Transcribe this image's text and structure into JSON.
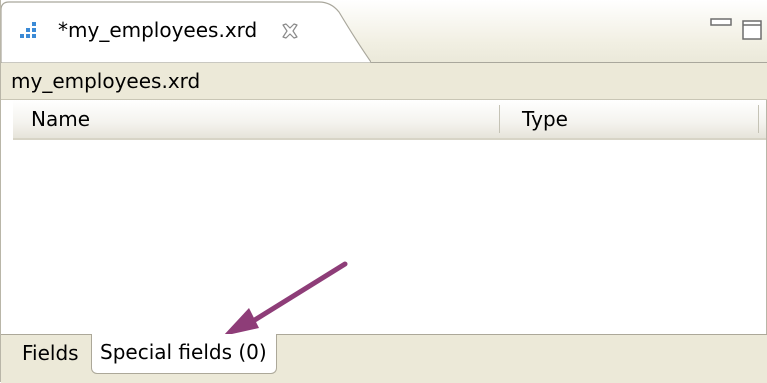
{
  "editor_tab": {
    "title": "*my_employees.xrd",
    "icon": "xrd-file-icon",
    "close_icon": "close-icon"
  },
  "window_controls": {
    "minimize_icon": "minimize-icon",
    "maximize_icon": "maximize-icon"
  },
  "path_bar": {
    "text": "my_employees.xrd"
  },
  "table": {
    "columns": [
      "Name",
      "Type"
    ],
    "rows": []
  },
  "bottom_tabs": [
    {
      "label": "Fields",
      "active": false
    },
    {
      "label": "Special fields (0)",
      "active": true
    }
  ],
  "annotation": {
    "arrow_color": "#8e3d78"
  },
  "colors": {
    "chrome": "#ece9d8",
    "border": "#aca899",
    "icon_blue": "#3b8ad6"
  }
}
